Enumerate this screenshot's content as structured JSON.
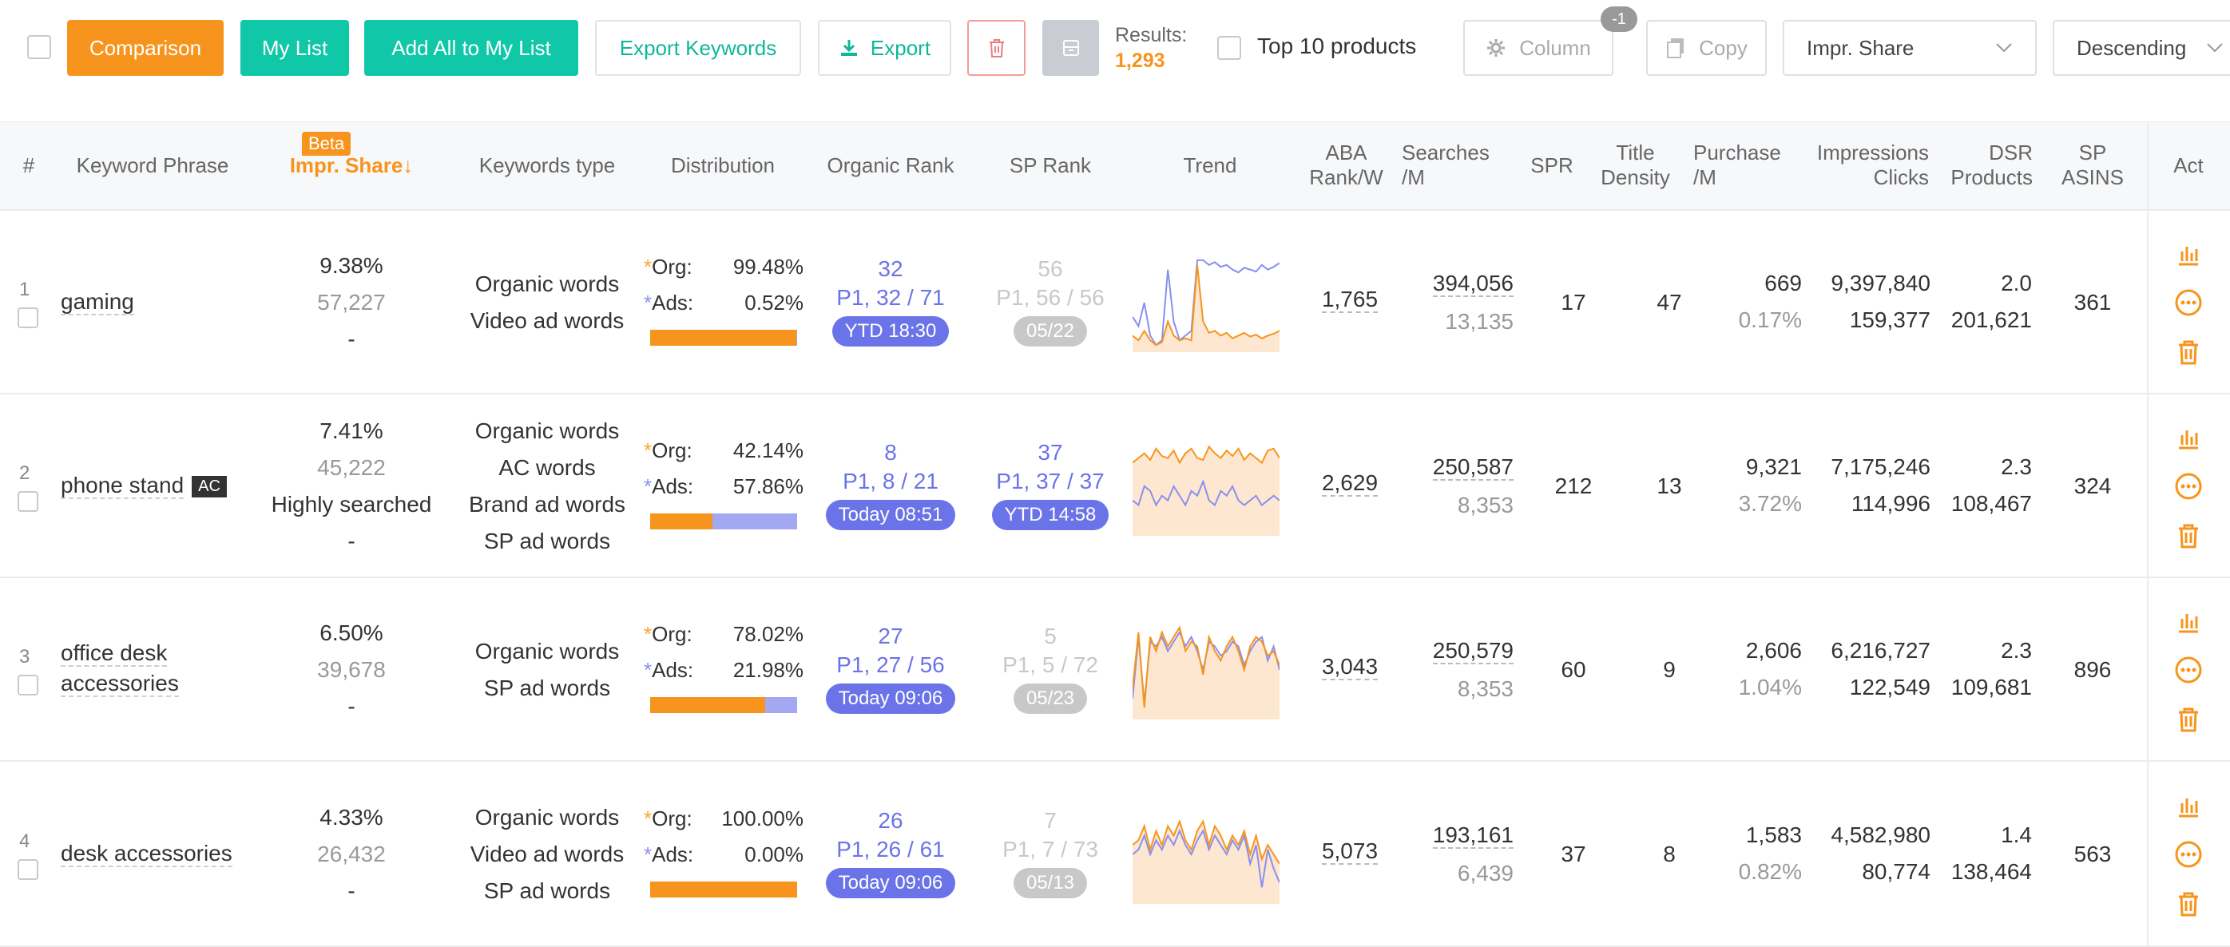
{
  "toolbar": {
    "comparison": "Comparison",
    "my_list": "My List",
    "add_all": "Add All to My List",
    "export_keywords": "Export Keywords",
    "export": "Export",
    "results_label": "Results:",
    "results_count": "1,293",
    "top10": "Top 10 products",
    "column": "Column",
    "column_badge": "-1",
    "copy": "Copy",
    "sort_field": "Impr. Share",
    "sort_order": "Descending"
  },
  "colors": {
    "orange": "#f7941d",
    "green": "#10c8a8",
    "blue": "#6b73e8",
    "gray": "#c8c8c8"
  },
  "headers": {
    "index": "#",
    "keyword": "Keyword Phrase",
    "beta": "Beta",
    "impr_share": "Impr. Share↓",
    "kw_type": "Keywords type",
    "distribution": "Distribution",
    "organic_rank": "Organic Rank",
    "sp_rank": "SP Rank",
    "trend": "Trend",
    "aba_1": "ABA",
    "aba_2": "Rank/W",
    "searches_1": "Searches",
    "searches_2": "/M",
    "spr": "SPR",
    "title_1": "Title",
    "title_2": "Density",
    "purchase_1": "Purchase",
    "purchase_2": "/M",
    "impr_1": "Impressions",
    "impr_2": "Clicks",
    "dsr_1": "DSR",
    "dsr_2": "Products",
    "sp_1": "SP",
    "sp_2": "ASINS",
    "act": "Act"
  },
  "rows": [
    {
      "index": "1",
      "keyword": "gaming",
      "ac": "",
      "share": "9.38%",
      "share_sub": "57,227",
      "share_extra": "",
      "share_dash": "-",
      "types": [
        "Organic words",
        "Video ad words"
      ],
      "org_label": "Org:",
      "org_value": "99.48%",
      "ads_label": "Ads:",
      "ads_value": "0.52%",
      "org_fraction": 0.9948,
      "org_rank": "32",
      "org_rank_sub": "P1, 32 / 71",
      "org_rank_pill": "YTD 18:30",
      "sp_rank": "56",
      "sp_rank_sub": "P1, 56 / 56",
      "sp_rank_pill": "05/22",
      "sp_active": false,
      "aba": "1,765",
      "searches": "394,056",
      "searches_sub": "13,135",
      "spr": "17",
      "title_density": "47",
      "purchase": "669",
      "purchase_sub": "0.17%",
      "impressions": "9,397,840",
      "clicks": "159,377",
      "dsr": "2.0",
      "products": "201,621",
      "sp_asins": "361",
      "trend_blue": [
        0.35,
        0.25,
        0.5,
        0.15,
        0.05,
        0.1,
        0.85,
        0.3,
        0.1,
        0.15,
        0.2,
        0.95,
        0.95,
        0.9,
        0.93,
        0.88,
        0.9,
        0.85,
        0.82,
        0.87,
        0.85,
        0.83,
        0.9,
        0.85,
        0.88,
        0.92
      ],
      "trend_orange": [
        0.15,
        0.1,
        0.2,
        0.1,
        0.05,
        0.08,
        0.3,
        0.15,
        0.1,
        0.12,
        0.1,
        0.9,
        0.3,
        0.18,
        0.2,
        0.15,
        0.18,
        0.12,
        0.15,
        0.18,
        0.14,
        0.16,
        0.12,
        0.15,
        0.17,
        0.2
      ]
    },
    {
      "index": "2",
      "keyword": "phone stand",
      "ac": "AC",
      "share": "7.41%",
      "share_sub": "45,222",
      "share_extra": "Highly searched",
      "share_dash": "-",
      "types": [
        "Organic words",
        "AC words",
        "Brand ad words",
        "SP ad words"
      ],
      "org_label": "Org:",
      "org_value": "42.14%",
      "ads_label": "Ads:",
      "ads_value": "57.86%",
      "org_fraction": 0.4214,
      "org_rank": "8",
      "org_rank_sub": "P1, 8 / 21",
      "org_rank_pill": "Today 08:51",
      "sp_rank": "37",
      "sp_rank_sub": "P1, 37 / 37",
      "sp_rank_pill": "YTD 14:58",
      "sp_active": true,
      "aba": "2,629",
      "searches": "250,587",
      "searches_sub": "8,353",
      "spr": "212",
      "title_density": "13",
      "purchase": "9,321",
      "purchase_sub": "3.72%",
      "impressions": "7,175,246",
      "clicks": "114,996",
      "dsr": "2.3",
      "products": "108,467",
      "sp_asins": "324",
      "trend_blue": [
        0.35,
        0.3,
        0.5,
        0.45,
        0.3,
        0.4,
        0.35,
        0.5,
        0.4,
        0.3,
        0.45,
        0.4,
        0.55,
        0.35,
        0.3,
        0.45,
        0.4,
        0.5,
        0.35,
        0.3,
        0.35,
        0.4,
        0.3,
        0.35,
        0.4,
        0.35
      ],
      "trend_orange": [
        0.75,
        0.8,
        0.85,
        0.78,
        0.9,
        0.82,
        0.8,
        0.88,
        0.75,
        0.85,
        0.9,
        0.8,
        0.78,
        0.92,
        0.85,
        0.8,
        0.88,
        0.82,
        0.9,
        0.78,
        0.85,
        0.8,
        0.75,
        0.88,
        0.9,
        0.8
      ]
    },
    {
      "index": "3",
      "keyword": "office desk accessories",
      "ac": "",
      "share": "6.50%",
      "share_sub": "39,678",
      "share_extra": "",
      "share_dash": "-",
      "types": [
        "Organic words",
        "SP ad words"
      ],
      "org_label": "Org:",
      "org_value": "78.02%",
      "ads_label": "Ads:",
      "ads_value": "21.98%",
      "org_fraction": 0.7802,
      "org_rank": "27",
      "org_rank_sub": "P1, 27 / 56",
      "org_rank_pill": "Today 09:06",
      "sp_rank": "5",
      "sp_rank_sub": "P1, 5 / 72",
      "sp_rank_pill": "05/23",
      "sp_active": false,
      "aba": "3,043",
      "searches": "250,579",
      "searches_sub": "8,353",
      "spr": "60",
      "title_density": "9",
      "purchase": "2,606",
      "purchase_sub": "1.04%",
      "impressions": "6,216,727",
      "clicks": "122,549",
      "dsr": "2.3",
      "products": "109,681",
      "sp_asins": "896",
      "trend_blue": [
        0.2,
        0.85,
        0.15,
        0.8,
        0.75,
        0.85,
        0.7,
        0.8,
        0.9,
        0.75,
        0.85,
        0.7,
        0.5,
        0.8,
        0.75,
        0.65,
        0.7,
        0.8,
        0.75,
        0.55,
        0.7,
        0.8,
        0.85,
        0.6,
        0.75,
        0.5
      ],
      "trend_orange": [
        0.3,
        0.9,
        0.1,
        0.85,
        0.7,
        0.9,
        0.75,
        0.85,
        0.95,
        0.7,
        0.8,
        0.75,
        0.45,
        0.85,
        0.7,
        0.6,
        0.75,
        0.85,
        0.7,
        0.5,
        0.75,
        0.85,
        0.8,
        0.65,
        0.7,
        0.55
      ]
    },
    {
      "index": "4",
      "keyword": "desk accessories",
      "ac": "",
      "share": "4.33%",
      "share_sub": "26,432",
      "share_extra": "",
      "share_dash": "-",
      "types": [
        "Organic words",
        "Video ad words",
        "SP ad words"
      ],
      "org_label": "Org:",
      "org_value": "100.00%",
      "ads_label": "Ads:",
      "ads_value": "0.00%",
      "org_fraction": 1.0,
      "org_rank": "26",
      "org_rank_sub": "P1, 26 / 61",
      "org_rank_pill": "Today 09:06",
      "sp_rank": "7",
      "sp_rank_sub": "P1, 7 / 73",
      "sp_rank_pill": "05/13",
      "sp_active": false,
      "aba": "5,073",
      "searches": "193,161",
      "searches_sub": "6,439",
      "spr": "37",
      "title_density": "8",
      "purchase": "1,583",
      "purchase_sub": "0.82%",
      "impressions": "4,582,980",
      "clicks": "80,774",
      "dsr": "1.4",
      "products": "138,464",
      "sp_asins": "563",
      "trend_blue": [
        0.5,
        0.55,
        0.7,
        0.5,
        0.65,
        0.55,
        0.7,
        0.6,
        0.75,
        0.6,
        0.5,
        0.65,
        0.75,
        0.55,
        0.7,
        0.6,
        0.5,
        0.65,
        0.55,
        0.7,
        0.4,
        0.6,
        0.15,
        0.55,
        0.35,
        0.2
      ],
      "trend_orange": [
        0.6,
        0.65,
        0.8,
        0.55,
        0.75,
        0.6,
        0.8,
        0.7,
        0.85,
        0.65,
        0.55,
        0.75,
        0.85,
        0.6,
        0.8,
        0.7,
        0.55,
        0.7,
        0.6,
        0.75,
        0.5,
        0.7,
        0.45,
        0.6,
        0.5,
        0.4
      ]
    }
  ]
}
